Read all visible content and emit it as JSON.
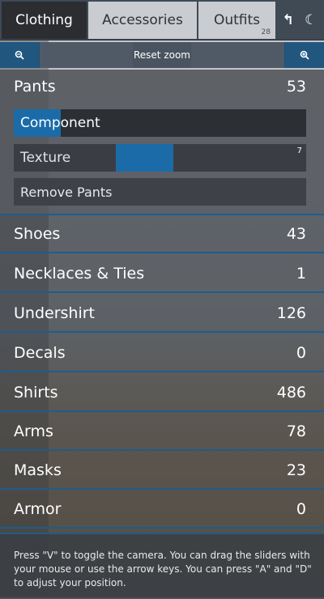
{
  "tabs": [
    {
      "label": "Clothing",
      "active": true
    },
    {
      "label": "Accessories",
      "active": false
    },
    {
      "label": "Outfits",
      "active": false,
      "badge": "28"
    }
  ],
  "top_icons": {
    "arrow": "↰",
    "moon": "☾"
  },
  "zoom_bar": {
    "zoom_out_icon": "zoom-out-icon",
    "zoom_in_icon": "zoom-in-icon",
    "reset_label": "Reset zoom"
  },
  "expanded_category": {
    "name": "Pants",
    "count": "53",
    "component": {
      "label": "Component",
      "level": 0.16
    },
    "texture": {
      "label": "Texture",
      "max": "7",
      "level_start": 0.35,
      "level_end": 0.545
    },
    "remove_label": "Remove Pants"
  },
  "categories": [
    {
      "name": "Shoes",
      "count": "43"
    },
    {
      "name": "Necklaces & Ties",
      "count": "1"
    },
    {
      "name": "Undershirt",
      "count": "126"
    },
    {
      "name": "Decals",
      "count": "0"
    },
    {
      "name": "Shirts",
      "count": "486"
    },
    {
      "name": "Arms",
      "count": "78"
    },
    {
      "name": "Masks",
      "count": "23"
    },
    {
      "name": "Armor",
      "count": "0"
    }
  ],
  "help_text": "Press \"V\" to toggle the camera. You can drag the sliders with your mouse or use the arrow keys. You can press \"A\" and \"D\" to adjust your position.",
  "colors": {
    "accent": "#1b6ba8",
    "active_tab": "#2b2d30"
  }
}
